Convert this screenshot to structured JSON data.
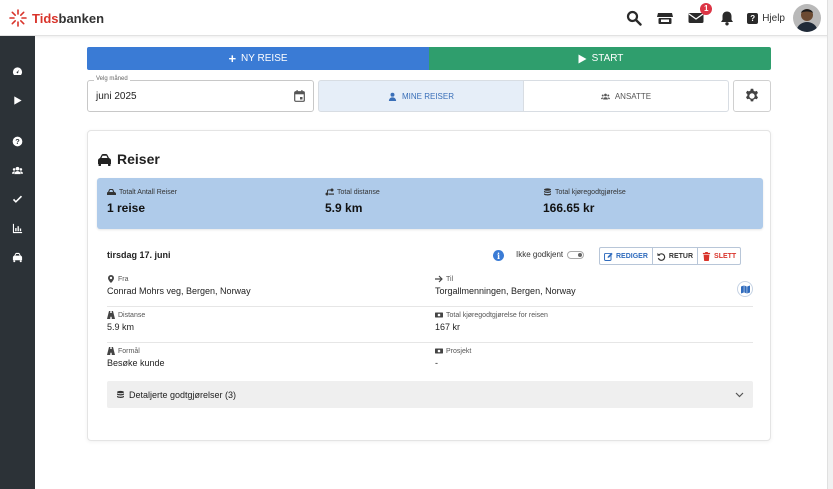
{
  "app": {
    "logo_red": "Tids",
    "logo_dark": "banken"
  },
  "topbar": {
    "notification_count": "1",
    "help_label": "Hjelp"
  },
  "actions": {
    "new_trip": "NY REISE",
    "start": "START"
  },
  "filter": {
    "month_label": "Velg måned",
    "month_value": "juni 2025",
    "my_trips": "MINE REISER",
    "employees": "ANSATTE"
  },
  "card": {
    "title": "Reiser",
    "summary": {
      "total_trips_label": "Totalt Antall Reiser",
      "total_trips_value": "1 reise",
      "distance_label": "Total distanse",
      "distance_value": "5.9 km",
      "allowance_label": "Total kjøregodtgjørelse",
      "allowance_value": "166.65 kr"
    },
    "trip": {
      "date": "tirsdag 17. juni",
      "approval_label": "Ikke godkjent",
      "edit": "REDIGER",
      "return": "RETUR",
      "delete": "SLETT",
      "from_label": "Fra",
      "from_value": "Conrad Mohrs veg, Bergen, Norway",
      "to_label": "Til",
      "to_value": "Torgallmenningen, Bergen, Norway",
      "distance_label": "Distanse",
      "distance_value": "5.9 km",
      "trip_allowance_label": "Total kjøregodtgjørelse for reisen",
      "trip_allowance_value": "167 kr",
      "purpose_label": "Formål",
      "purpose_value": "Besøke kunde",
      "project_label": "Prosjekt",
      "project_value": "-",
      "details_label": "Detaljerte godtgjørelser (3)"
    }
  },
  "colors": {
    "primary": "#3a7bd5",
    "success": "#2f9e6d",
    "sidebar": "#2c3237",
    "summary": "#afcbea",
    "danger": "#d9342b"
  }
}
